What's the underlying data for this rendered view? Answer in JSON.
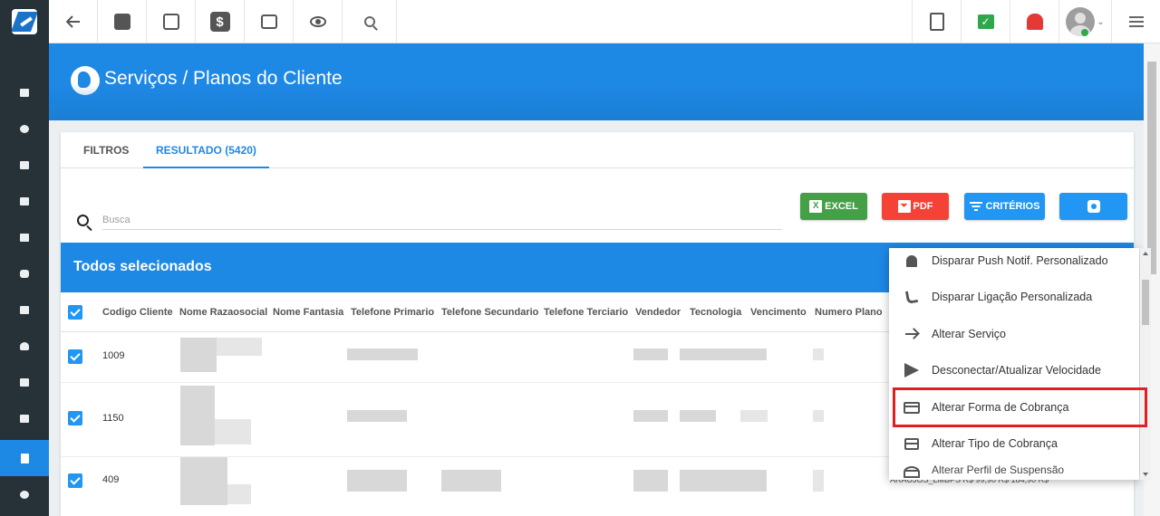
{
  "app": {
    "page_title": "Serviços / Planos do Cliente"
  },
  "topbar": {
    "left_icons": [
      "back-arrow-icon",
      "contact-card-icon",
      "calendar-clock-icon",
      "dollar-icon",
      "terminal-icon",
      "eye-icon",
      "search-icon"
    ],
    "right_icons": [
      "pdf-icon",
      "check-message-icon",
      "alarm-bell-icon",
      "user-avatar",
      "list-icon"
    ],
    "colors": {
      "check": "#2ea84a",
      "alarm": "#e53935"
    }
  },
  "sidebar": {
    "items": [
      "dashboard-icon",
      "pie-chart-icon",
      "contact-icon",
      "board-icon",
      "calendar-icon",
      "cube-icon",
      "id-card-icon",
      "location-icon",
      "document-icon",
      "server-icon",
      "file-icon",
      "gear-icon"
    ],
    "active_index": 10,
    "colors": {
      "background": "#263238",
      "active": "#1e88e5"
    }
  },
  "tabs": [
    {
      "label": "FILTROS",
      "active": false
    },
    {
      "label": "RESULTADO (5420)",
      "active": true
    }
  ],
  "search": {
    "placeholder": "Busca",
    "value": ""
  },
  "actions": {
    "excel_label": "EXCEL",
    "pdf_label": "PDF",
    "criteria_label": "CRITÉRIOS",
    "settings_icon": "gear-icon",
    "colors": {
      "excel": "#43a047",
      "pdf": "#f44336",
      "criteria": "#2196f3",
      "settings": "#2196f3"
    }
  },
  "selection_bar": {
    "title": "Todos selecionados",
    "color": "#1e88e5"
  },
  "table": {
    "columns": [
      "Codigo Cliente",
      "Nome Razaosocial",
      "Nome Fantasia",
      "Telefone Primario",
      "Telefone Secundario",
      "Telefone Terciario",
      "Vendedor",
      "Tecnologia",
      "Vencimento",
      "Numero Plano"
    ],
    "rows": [
      {
        "codigo": "1009",
        "checked": true
      },
      {
        "codigo": "1150",
        "checked": true
      },
      {
        "codigo": "409",
        "checked": true,
        "trailing": "ARAUJOS_LMBPS   R$ 99,90   R$ 184,90   R$"
      }
    ]
  },
  "context_menu": {
    "items": [
      {
        "label": "Disparar Push Notif. Personalizado",
        "icon": "bell-icon"
      },
      {
        "label": "Disparar Ligação Personalizada",
        "icon": "phone-icon"
      },
      {
        "label": "Alterar Serviço",
        "icon": "arrow-right-icon"
      },
      {
        "label": "Desconectar/Atualizar Velocidade",
        "icon": "send-icon"
      },
      {
        "label": "Alterar Forma de Cobrança",
        "icon": "credit-card-icon",
        "highlighted": true
      },
      {
        "label": "Alterar Tipo de Cobrança",
        "icon": "gift-card-icon"
      },
      {
        "label": "Alterar Perfil de Suspensão",
        "icon": "speed-icon",
        "partially_visible": true
      }
    ],
    "highlight_color": "#e02020"
  }
}
